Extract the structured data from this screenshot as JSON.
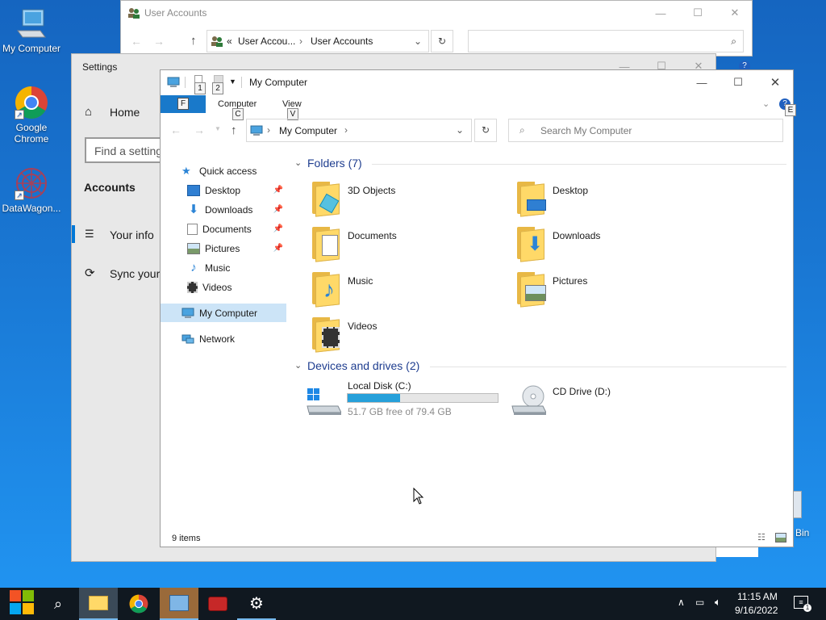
{
  "desktop": {
    "icons": [
      {
        "label": "My Computer"
      },
      {
        "label": "Google Chrome"
      },
      {
        "label": "DataWagon..."
      }
    ],
    "recycle_bin_partial": "Bin"
  },
  "user_accounts": {
    "title": "User Accounts",
    "breadcrumb_prefix": "«",
    "crumb1": "User Accou...",
    "crumb2": "User Accounts"
  },
  "settings": {
    "title": "Settings",
    "home_label": "Home",
    "search_placeholder": "Find a setting",
    "section": "Accounts",
    "items": [
      {
        "label": "Your info"
      },
      {
        "label": "Sync your"
      }
    ]
  },
  "explorer": {
    "title": "My Computer",
    "qat_keytips": [
      "1",
      "2"
    ],
    "ribbon": {
      "file_keytip": "F",
      "tabs": [
        {
          "label": "Computer",
          "keytip": "C"
        },
        {
          "label": "View",
          "keytip": "V"
        }
      ],
      "help_keytip": "E"
    },
    "address": {
      "location": "My Computer"
    },
    "search_placeholder": "Search My Computer",
    "nav": {
      "quick_access": "Quick access",
      "items": [
        {
          "label": "Desktop",
          "pinned": true
        },
        {
          "label": "Downloads",
          "pinned": true
        },
        {
          "label": "Documents",
          "pinned": true
        },
        {
          "label": "Pictures",
          "pinned": true
        },
        {
          "label": "Music",
          "pinned": false
        },
        {
          "label": "Videos",
          "pinned": false
        }
      ],
      "this_pc": "My Computer",
      "network": "Network"
    },
    "folders_header": "Folders (7)",
    "folders": [
      {
        "label": "3D Objects"
      },
      {
        "label": "Desktop"
      },
      {
        "label": "Documents"
      },
      {
        "label": "Downloads"
      },
      {
        "label": "Music"
      },
      {
        "label": "Pictures"
      },
      {
        "label": "Videos"
      }
    ],
    "devices_header": "Devices and drives (2)",
    "drives": [
      {
        "label": "Local Disk (C:)",
        "free_text": "51.7 GB free of 79.4 GB",
        "used_fraction": 0.35
      },
      {
        "label": "CD Drive (D:)"
      }
    ],
    "status": "9 items"
  },
  "taskbar": {
    "time": "11:15 AM",
    "date": "9/16/2022"
  },
  "colors": {
    "accent": "#0078d7",
    "drive_bar": "#26a0da",
    "taskbar": "#101820",
    "folder_yellow": "#ffd968"
  }
}
